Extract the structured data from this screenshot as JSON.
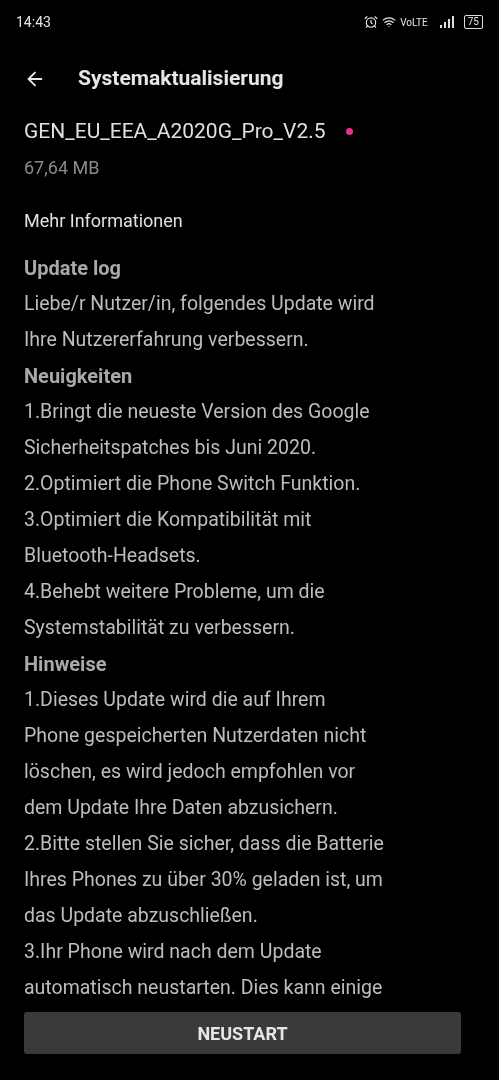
{
  "status_bar": {
    "time": "14:43",
    "network": "VoLTE",
    "battery": "75"
  },
  "header": {
    "title": "Systemaktualisierung"
  },
  "update": {
    "version": "GEN_EU_EEA_A2020G_Pro_V2.5",
    "new": true,
    "size": "67,64 MB"
  },
  "more_info": "Mehr Informationen",
  "sections": [
    {
      "heading": "Update log",
      "paragraphs": [
        [
          "Liebe/r Nutzer/in, folgendes Update wird",
          "Ihre Nutzererfahrung verbessern."
        ]
      ]
    },
    {
      "heading": "Neuigkeiten",
      "paragraphs": [
        [
          "1.Bringt die neueste Version des Google",
          "Sicherheitspatches bis Juni 2020."
        ],
        [
          "2.Optimiert die Phone Switch Funktion."
        ],
        [
          "3.Optimiert die Kompatibilität mit",
          "Bluetooth-Headsets."
        ],
        [
          "4.Behebt weitere Probleme, um die",
          "Systemstabilität zu verbessern."
        ]
      ]
    },
    {
      "heading": "Hinweise",
      "paragraphs": [
        [
          "1.Dieses Update wird die auf Ihrem",
          "Phone gespeicherten Nutzerdaten nicht",
          "löschen, es wird jedoch empfohlen vor",
          "dem Update Ihre Daten abzusichern."
        ],
        [
          "2.Bitte stellen Sie sicher, dass die Batterie",
          "Ihres Phones zu über 30% geladen ist, um",
          "das Update abzuschließen."
        ],
        [
          "3.Ihr Phone wird nach dem Update",
          "automatisch neustarten. Dies kann einige"
        ]
      ]
    }
  ],
  "button": "NEUSTART"
}
